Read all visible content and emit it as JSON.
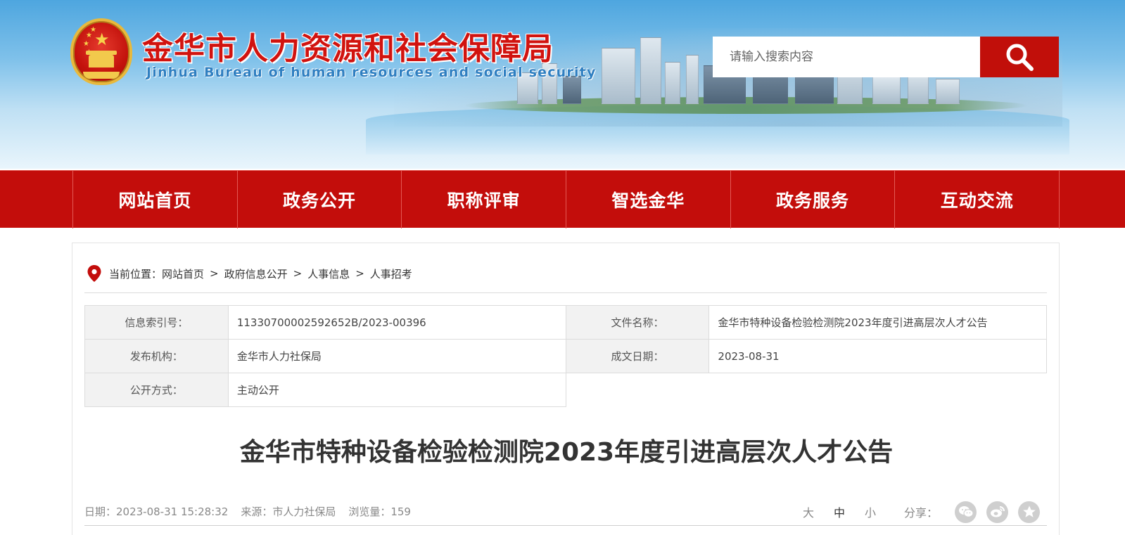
{
  "header": {
    "title": "金华市人力资源和社会保障局",
    "subtitle": "Jinhua Bureau of human resources and social security",
    "search_placeholder": "请输入搜索内容"
  },
  "nav": {
    "items": [
      {
        "label": "网站首页"
      },
      {
        "label": "政务公开"
      },
      {
        "label": "职称评审"
      },
      {
        "label": "智选金华"
      },
      {
        "label": "政务服务"
      },
      {
        "label": "互动交流"
      }
    ]
  },
  "breadcrumb": {
    "prefix": "当前位置：",
    "items": [
      "网站首页",
      "政府信息公开",
      "人事信息",
      "人事招考"
    ],
    "separator": ">"
  },
  "meta": {
    "index_label": "信息索引号：",
    "index_value": "11330700002592652B/2023-00396",
    "filename_label": "文件名称：",
    "filename_value": "金华市特种设备检验检测院2023年度引进高层次人才公告",
    "publisher_label": "发布机构：",
    "publisher_value": "金华市人力社保局",
    "date_label": "成文日期：",
    "date_value": "2023-08-31",
    "disclosure_label": "公开方式：",
    "disclosure_value": "主动公开"
  },
  "article": {
    "title": "金华市特种设备检验检测院2023年度引进高层次人才公告",
    "date": "日期：2023-08-31 15:28:32",
    "source": "来源：市人力社保局",
    "views": "浏览量：159",
    "font_large": "大",
    "font_medium": "中",
    "font_small": "小",
    "share_label": "分享："
  },
  "colors": {
    "brand_red": "#c30d0b",
    "title_red": "#d1130f",
    "subtitle_blue": "#2f7fc1"
  },
  "icons": [
    "national-emblem-icon",
    "search-icon",
    "location-pin-icon",
    "wechat-icon",
    "weibo-icon",
    "star-icon"
  ]
}
